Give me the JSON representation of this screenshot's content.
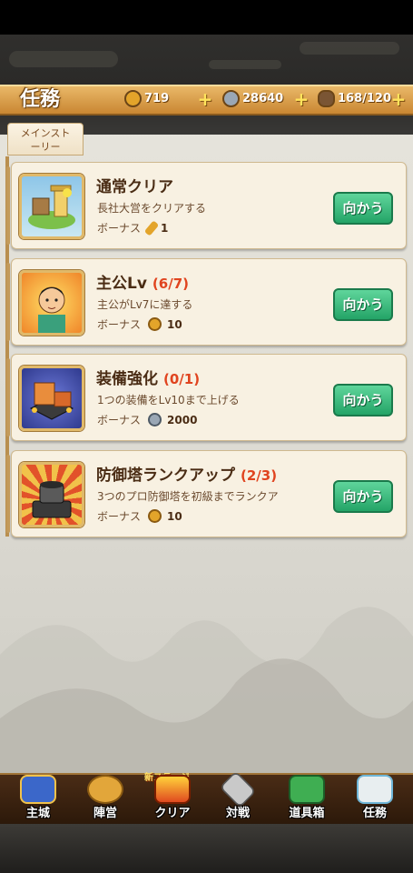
{
  "header": {
    "title": "任務",
    "resources": [
      {
        "name": "gold",
        "value": "719",
        "color": "#e3a42a"
      },
      {
        "name": "silver",
        "value": "28640",
        "color": "#9aa7b5"
      },
      {
        "name": "stamina",
        "value": "168/120",
        "color": "#7a5534"
      }
    ]
  },
  "tabs": [
    {
      "label": "メインストーリー",
      "line1": "メインスト",
      "line2": "ーリー"
    }
  ],
  "bonus_label": "ボーナス",
  "go_label": "向かう",
  "quests": [
    {
      "title": "通常クリア",
      "progress": "",
      "desc": "長社大営をクリアする",
      "reward_icon": "key-icon",
      "reward": "1"
    },
    {
      "title": "主公Lv",
      "progress": "(6/7)",
      "desc": "主公がLv7に達する",
      "reward_icon": "gold-coin-icon",
      "reward": "10"
    },
    {
      "title": "装備強化",
      "progress": "(0/1)",
      "desc": "1つの装備をLv10まで上げる",
      "reward_icon": "silver-coin-icon",
      "reward": "2000"
    },
    {
      "title": "防御塔ランクアップ",
      "progress": "(2/3)",
      "desc": "3つのプロ防御塔を初級までランクア",
      "reward_icon": "gold-coin-icon",
      "reward": "10"
    }
  ],
  "nav": {
    "new_tag": "新ステージ",
    "items": [
      {
        "label": "主城",
        "icon": "castle-icon",
        "color": "#3b67c9"
      },
      {
        "label": "陣営",
        "icon": "lion-icon",
        "color": "#e2a63a"
      },
      {
        "label": "クリア",
        "icon": "battle-flag-icon",
        "color": "#e04a20"
      },
      {
        "label": "対戦",
        "icon": "swords-icon",
        "color": "#c9c9c9"
      },
      {
        "label": "道具箱",
        "icon": "chest-icon",
        "color": "#3fae52"
      },
      {
        "label": "任務",
        "icon": "scroll-icon",
        "color": "#6fb6d8"
      }
    ]
  }
}
